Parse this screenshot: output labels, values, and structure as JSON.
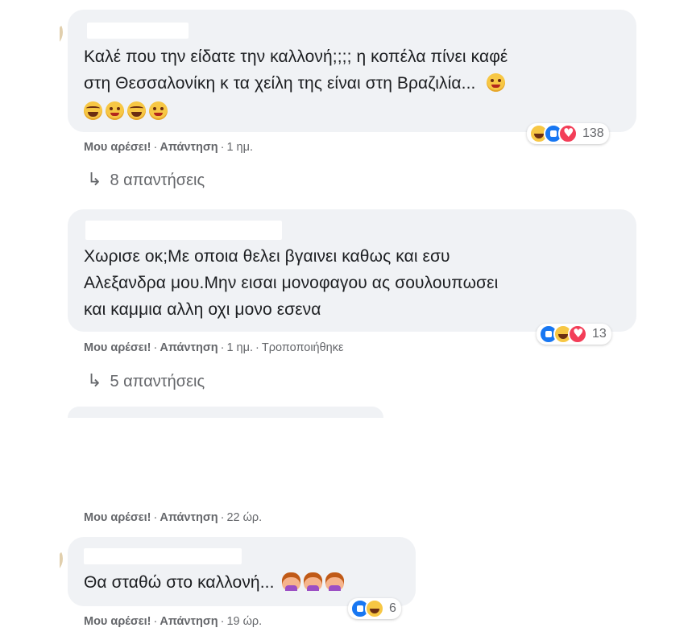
{
  "comments": [
    {
      "lines": [
        "Καλέ που την είδατε την καλλονή;;;; η κοπέλα πίνει καφέ",
        "στη Θεσσαλονίκη κ τα χείλη της είναι στη Βραζιλία..."
      ],
      "emojis_inline": [
        "wink-emoji"
      ],
      "emojis_line3": [
        "laugh-tears-emoji",
        "wink-emoji",
        "laugh-tears-emoji",
        "wink-emoji"
      ],
      "reaction_icons": [
        "haha",
        "like",
        "love"
      ],
      "reaction_count": "138",
      "like_label": "Μου αρέσει!",
      "reply_label": "Απάντηση",
      "time": "1 ημ.",
      "edited": "",
      "replies": "8 απαντήσεις"
    },
    {
      "lines": [
        "Χωρισε οκ;Με οποια θελει βγαινει καθως και εσυ",
        "Αλεξανδρα μου.Μην εισαι μονοφαγου ας σουλουπωσει",
        "και καμμια αλλη οχι μονο εσενα"
      ],
      "reaction_icons": [
        "like",
        "haha",
        "love"
      ],
      "reaction_count": "13",
      "like_label": "Μου αρέσει!",
      "reply_label": "Απάντηση",
      "time": "1 ημ.",
      "edited": "Τροποποιήθηκε",
      "replies": "5 απαντήσεις"
    },
    {
      "like_label": "Μου αρέσει!",
      "reply_label": "Απάντηση",
      "time": "22 ώρ."
    },
    {
      "lines": [
        "Θα σταθώ στο καλλονή..."
      ],
      "emojis_inline": [
        "woman-facepalming-emoji",
        "woman-facepalming-emoji",
        "woman-facepalming-emoji"
      ],
      "reaction_icons": [
        "like",
        "haha"
      ],
      "reaction_count": "6",
      "like_label": "Μου αρέσει!",
      "reply_label": "Απάντηση",
      "time": "19 ώρ."
    }
  ],
  "colors": {
    "bubble": "#f0f2f5",
    "meta": "#65676b",
    "like": "#1877f2",
    "love": "#f33e58",
    "haha": "#f7c744"
  }
}
